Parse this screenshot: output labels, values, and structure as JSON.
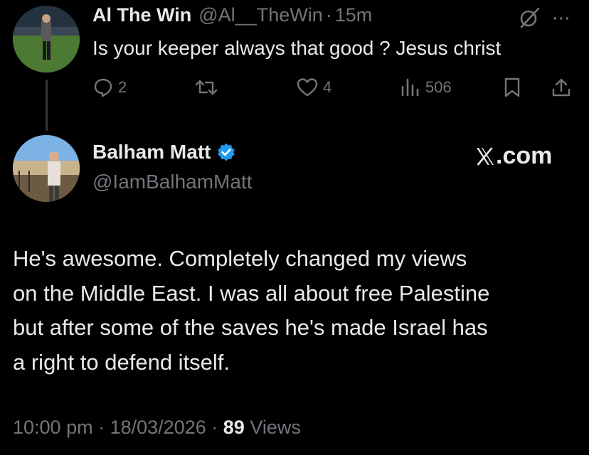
{
  "reply_tweet": {
    "display_name": "Al The Win",
    "handle": "@Al__TheWin",
    "separator": "·",
    "time": "15m",
    "text": "Is your keeper always that good ? Jesus christ",
    "actions": {
      "reply_count": "2",
      "retweet_count": "",
      "like_count": "4",
      "views_count": "506"
    }
  },
  "main_tweet": {
    "display_name": "Balham Matt",
    "handle": "@IamBalhamMatt",
    "brand": ".com",
    "lines": [
      "He's awesome. Completely changed my views",
      "on the Middle East. I was all about free Palestine",
      "but after some of the saves he's made Israel has",
      "a right to defend itself."
    ],
    "time": "10:00 pm",
    "date": "18/03/2026",
    "separator": "·",
    "views_count": "89",
    "views_label": "Views"
  },
  "colors": {
    "background": "#000000",
    "primary_text": "#e7e9ea",
    "secondary_text": "#71767b",
    "verified_blue": "#1d9bf0"
  },
  "icons": [
    "grok-icon",
    "more-icon",
    "reply-icon",
    "retweet-icon",
    "like-icon",
    "views-icon",
    "bookmark-icon",
    "share-icon",
    "verified-icon",
    "x-logo-icon"
  ]
}
